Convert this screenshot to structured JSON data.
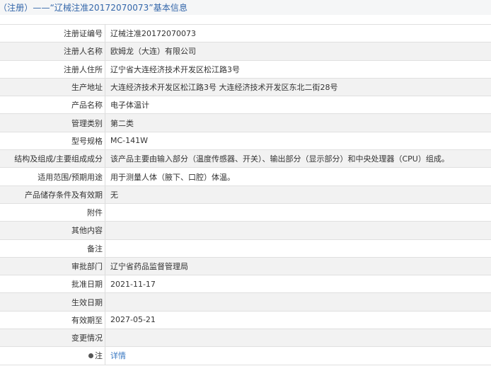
{
  "header": {
    "title": "（注册）——“辽械注准20172070073”基本信息"
  },
  "rows": [
    {
      "label": "注册证编号",
      "value": "辽械注准20172070073"
    },
    {
      "label": "注册人名称",
      "value": "欧姆龙（大连）有限公司"
    },
    {
      "label": "注册人住所",
      "value": "辽宁省大连经济技术开发区松江路3号"
    },
    {
      "label": "生产地址",
      "value": "大连经济技术开发区松江路3号 大连经济技术开发区东北二街28号"
    },
    {
      "label": "产品名称",
      "value": "电子体温计"
    },
    {
      "label": "管理类别",
      "value": "第二类"
    },
    {
      "label": "型号规格",
      "value": "MC-141W"
    },
    {
      "label": "结构及组成/主要组成成分",
      "value": "该产品主要由输入部分（温度传感器、开关）、输出部分（显示部分）和中央处理器（CPU）组成。"
    },
    {
      "label": "适用范围/预期用途",
      "value": "用于测量人体（腋下、口腔）体温。"
    },
    {
      "label": "产品储存条件及有效期",
      "value": "无"
    },
    {
      "label": "附件",
      "value": ""
    },
    {
      "label": "其他内容",
      "value": ""
    },
    {
      "label": "备注",
      "value": ""
    },
    {
      "label": "审批部门",
      "value": "辽宁省药品监督管理局"
    },
    {
      "label": "批准日期",
      "value": "2021-11-17"
    },
    {
      "label": "生效日期",
      "value": ""
    },
    {
      "label": "有效期至",
      "value": "2027-05-21"
    },
    {
      "label": "变更情况",
      "value": ""
    },
    {
      "label": "注",
      "value": "详情",
      "icon": "note-icon"
    }
  ]
}
